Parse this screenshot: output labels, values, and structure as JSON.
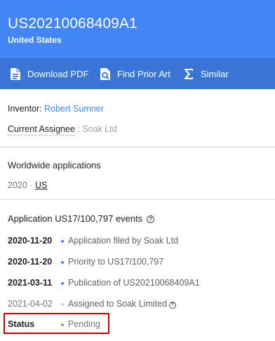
{
  "header": {
    "publication_number": "US20210068409A1",
    "country": "United States"
  },
  "toolbar": {
    "download_pdf": "Download PDF",
    "find_prior_art": "Find Prior Art",
    "similar": "Similar"
  },
  "people": {
    "inventor_label": "Inventor:",
    "inventor_name": "Robert Sumner",
    "assignee_label": "Current Assignee",
    "assignee_sep": ":",
    "assignee_name": "Soak Ltd"
  },
  "worldwide": {
    "title": "Worldwide applications",
    "year": "2020",
    "sep": "·",
    "country_link": "US"
  },
  "events": {
    "title": "Application US17/100,797 events",
    "items": [
      {
        "date": "2020-11-20",
        "text": "Application filed by Soak Ltd"
      },
      {
        "date": "2020-11-20",
        "text": "Priority to US17/100,797"
      },
      {
        "date": "2021-03-11",
        "text": "Publication of US20210068409A1"
      },
      {
        "date": "2021-04-02",
        "text": "Assigned to Soak Limited"
      }
    ]
  },
  "status": {
    "label": "Status",
    "value": "Pending"
  },
  "colors": {
    "header_bg": "#4285f4",
    "toolbar_bg": "#3a75d6",
    "link": "#4285f4",
    "event_dot_blue": "#4285f4",
    "event_dot_gray": "#cccccc",
    "status_dot_green": "#7cb342",
    "highlight_border": "#cc0000"
  },
  "icons": {
    "pdf": "file-download-icon",
    "prior_art": "document-search-icon",
    "similar": "sigma-icon",
    "info": "info-icon"
  }
}
